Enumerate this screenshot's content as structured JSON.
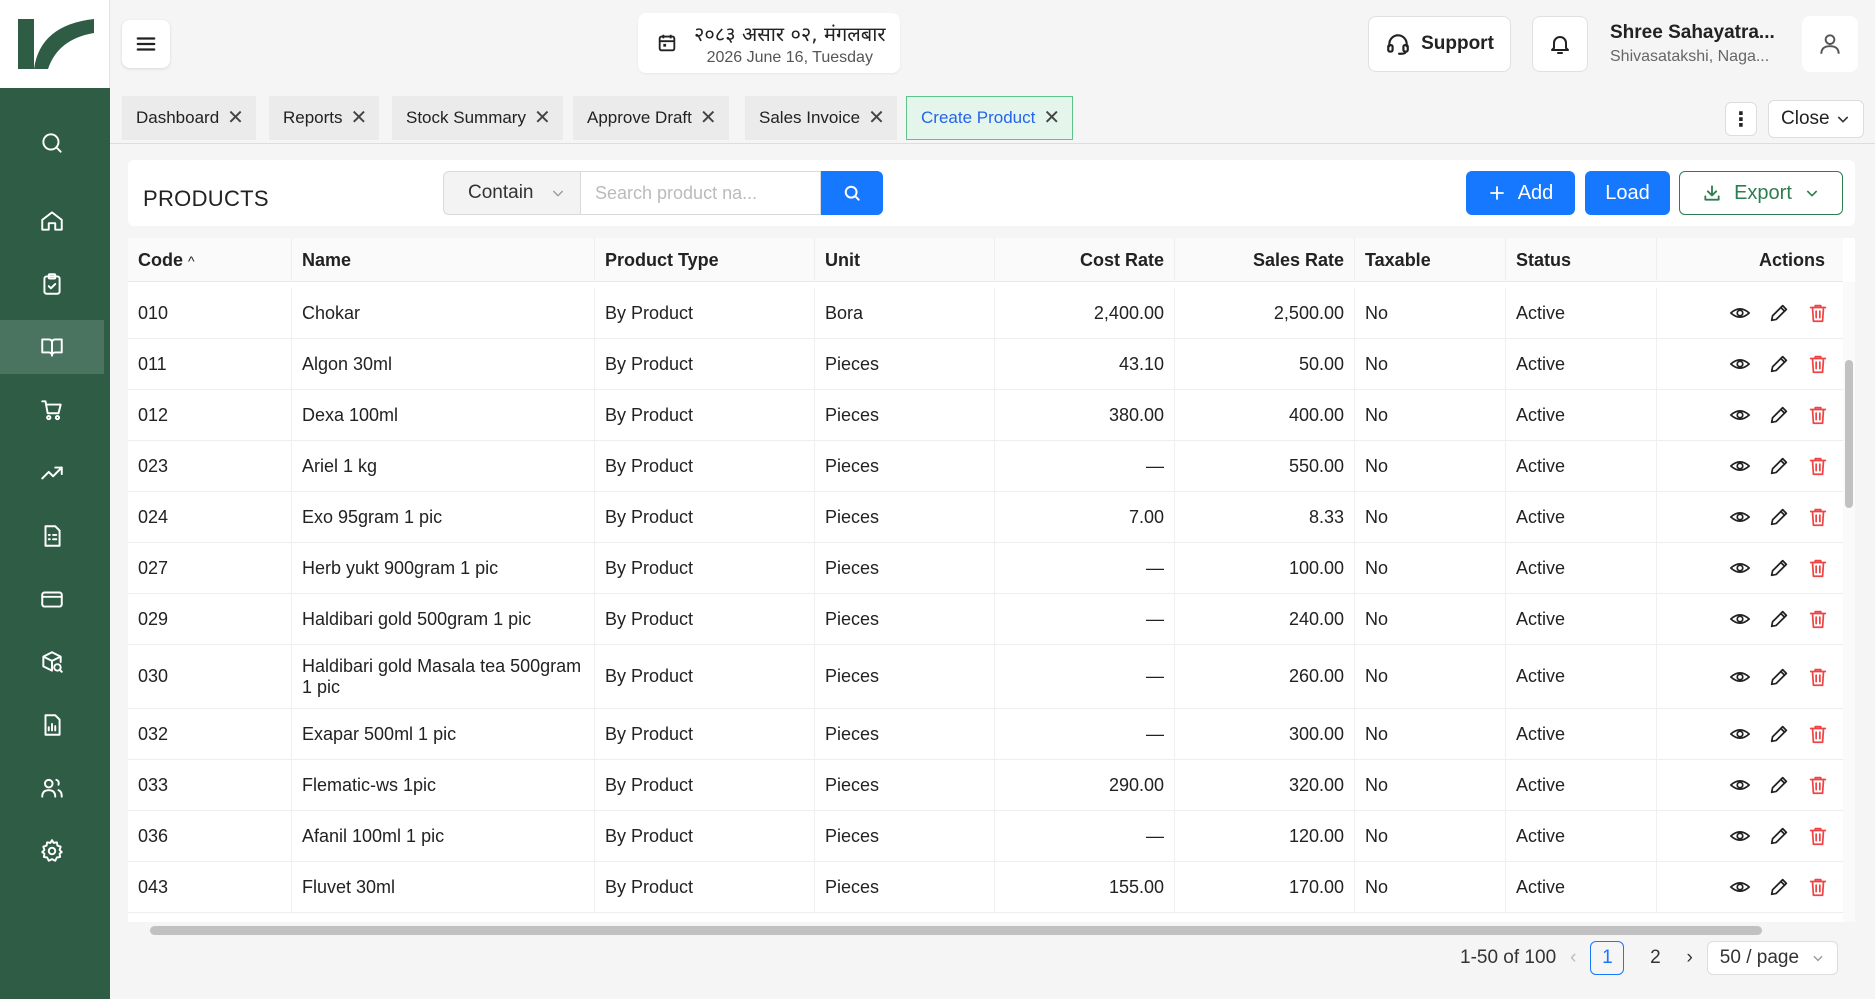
{
  "header": {
    "date_nepali": "२०८३ असार ०२, मंगलबार",
    "date_english": "2026 June 16, Tuesday",
    "support_label": "Support",
    "user_name": "Shree Sahayatra...",
    "user_location": "Shivasatakshi, Naga..."
  },
  "tabs": [
    {
      "label": "Dashboard"
    },
    {
      "label": "Reports"
    },
    {
      "label": "Stock Summary"
    },
    {
      "label": "Approve Draft"
    },
    {
      "label": "Sales Invoice"
    },
    {
      "label": "Create Product"
    }
  ],
  "tab_close_label": "Close",
  "page": {
    "title": "PRODUCTS",
    "filter_mode": "Contain",
    "search_placeholder": "Search product na...",
    "add_label": "Add",
    "load_label": "Load",
    "export_label": "Export"
  },
  "table": {
    "columns": [
      "Code",
      "Name",
      "Product Type",
      "Unit",
      "Cost Rate",
      "Sales Rate",
      "Taxable",
      "Status",
      "Actions"
    ],
    "sort_indicator": "^",
    "rows": [
      {
        "code": "010",
        "name": "Chokar",
        "type": "By Product",
        "unit": "Bora",
        "cost": "2,400.00",
        "sales": "2,500.00",
        "taxable": "No",
        "status": "Active"
      },
      {
        "code": "011",
        "name": "Algon 30ml",
        "type": "By Product",
        "unit": "Pieces",
        "cost": "43.10",
        "sales": "50.00",
        "taxable": "No",
        "status": "Active"
      },
      {
        "code": "012",
        "name": "Dexa 100ml",
        "type": "By Product",
        "unit": "Pieces",
        "cost": "380.00",
        "sales": "400.00",
        "taxable": "No",
        "status": "Active"
      },
      {
        "code": "023",
        "name": "Ariel 1 kg",
        "type": "By Product",
        "unit": "Pieces",
        "cost": "—",
        "sales": "550.00",
        "taxable": "No",
        "status": "Active"
      },
      {
        "code": "024",
        "name": "Exo 95gram 1 pic",
        "type": "By Product",
        "unit": "Pieces",
        "cost": "7.00",
        "sales": "8.33",
        "taxable": "No",
        "status": "Active"
      },
      {
        "code": "027",
        "name": "Herb yukt 900gram 1 pic",
        "type": "By Product",
        "unit": "Pieces",
        "cost": "—",
        "sales": "100.00",
        "taxable": "No",
        "status": "Active"
      },
      {
        "code": "029",
        "name": "Haldibari gold 500gram 1 pic",
        "type": "By Product",
        "unit": "Pieces",
        "cost": "—",
        "sales": "240.00",
        "taxable": "No",
        "status": "Active"
      },
      {
        "code": "030",
        "name": "Haldibari gold Masala tea 500gram 1 pic",
        "type": "By Product",
        "unit": "Pieces",
        "cost": "—",
        "sales": "260.00",
        "taxable": "No",
        "status": "Active"
      },
      {
        "code": "032",
        "name": "Exapar 500ml 1 pic",
        "type": "By Product",
        "unit": "Pieces",
        "cost": "—",
        "sales": "300.00",
        "taxable": "No",
        "status": "Active"
      },
      {
        "code": "033",
        "name": "Flematic-ws 1pic",
        "type": "By Product",
        "unit": "Pieces",
        "cost": "290.00",
        "sales": "320.00",
        "taxable": "No",
        "status": "Active"
      },
      {
        "code": "036",
        "name": "Afanil 100ml 1 pic",
        "type": "By Product",
        "unit": "Pieces",
        "cost": "—",
        "sales": "120.00",
        "taxable": "No",
        "status": "Active"
      },
      {
        "code": "043",
        "name": "Fluvet 30ml",
        "type": "By Product",
        "unit": "Pieces",
        "cost": "155.00",
        "sales": "170.00",
        "taxable": "No",
        "status": "Active"
      }
    ]
  },
  "pagination": {
    "range_text": "1-50 of 100",
    "pages": [
      "1",
      "2"
    ],
    "current": "1",
    "page_size": "50 / page"
  },
  "sidebar": {
    "items": [
      "search-icon",
      "home-icon",
      "clipboard-icon",
      "book-icon",
      "cart-icon",
      "trending-icon",
      "invoice-icon",
      "card-icon",
      "package-search-icon",
      "report-icon",
      "users-icon",
      "settings-icon"
    ],
    "active_index": 3
  },
  "colors": {
    "sidebar_bg": "#2e5c45",
    "primary": "#1677ff",
    "export_green": "#2e7d4f",
    "delete_red": "#ef4444"
  }
}
